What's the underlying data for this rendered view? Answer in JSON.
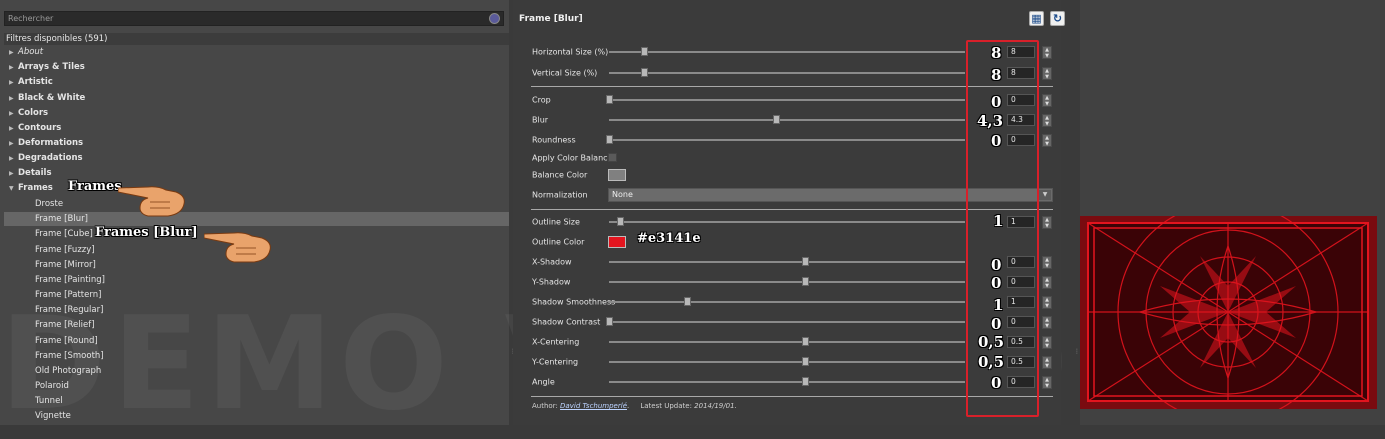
{
  "search": {
    "placeholder": "Rechercher"
  },
  "filters_header": "Filtres disponibles (591)",
  "tree": {
    "categories": [
      "About",
      "Arrays & Tiles",
      "Artistic",
      "Black & White",
      "Colors",
      "Contours",
      "Deformations",
      "Degradations",
      "Details",
      "Frames"
    ],
    "frames_children": [
      "Droste",
      "Frame [Blur]",
      "Frame [Cube]",
      "Frame [Fuzzy]",
      "Frame [Mirror]",
      "Frame [Painting]",
      "Frame [Pattern]",
      "Frame [Regular]",
      "Frame [Relief]",
      "Frame [Round]",
      "Frame [Smooth]",
      "Old Photograph",
      "Polaroid",
      "Tunnel",
      "Vignette"
    ],
    "selected": "Frame [Blur]"
  },
  "watermark": "DEMO VERSION",
  "annotations": {
    "frames": "Frames",
    "frame_blur": "Frames [Blur]",
    "outline_color_hex": "#e3141e",
    "values": [
      "8",
      "8",
      "0",
      "4,3",
      "0",
      "1",
      "0",
      "0",
      "1",
      "0",
      "0,5",
      "0,5",
      "0"
    ]
  },
  "panel": {
    "title": "Frame [Blur]",
    "params": {
      "horizontal_size": {
        "label": "Horizontal Size (%)",
        "value": "8",
        "fraction": 0.098
      },
      "vertical_size": {
        "label": "Vertical Size (%)",
        "value": "8",
        "fraction": 0.098
      },
      "crop": {
        "label": "Crop",
        "value": "0",
        "fraction": 0.0
      },
      "blur": {
        "label": "Blur",
        "value": "4.3",
        "fraction": 0.47
      },
      "roundness": {
        "label": "Roundness",
        "value": "0",
        "fraction": 0.0
      },
      "apply_color_balance": {
        "label": "Apply Color Balance",
        "checked": false
      },
      "balance_color": {
        "label": "Balance Color",
        "color": "#808080"
      },
      "normalization": {
        "label": "Normalization",
        "value": "None"
      },
      "outline_size": {
        "label": "Outline Size",
        "value": "1",
        "fraction": 0.03
      },
      "outline_color": {
        "label": "Outline Color",
        "color": "#e3141e"
      },
      "x_shadow": {
        "label": "X-Shadow",
        "value": "0",
        "fraction": 0.55
      },
      "y_shadow": {
        "label": "Y-Shadow",
        "value": "0",
        "fraction": 0.55
      },
      "shadow_smoothness": {
        "label": "Shadow Smoothness",
        "value": "1",
        "fraction": 0.22
      },
      "shadow_contrast": {
        "label": "Shadow Contrast",
        "value": "0",
        "fraction": 0.0
      },
      "x_centering": {
        "label": "X-Centering",
        "value": "0.5",
        "fraction": 0.55
      },
      "y_centering": {
        "label": "Y-Centering",
        "value": "0.5",
        "fraction": 0.55
      },
      "angle": {
        "label": "Angle",
        "value": "0",
        "fraction": 0.55
      }
    },
    "footer": {
      "author_label": "Author:",
      "author": "David Tschumperlé",
      "update_label": "Latest Update:",
      "update": "2014/19/01."
    }
  },
  "colors": {
    "highlight": "#d8202a",
    "outline": "#e3141e"
  },
  "icons": [
    "search-icon",
    "layers-icon",
    "refresh-icon",
    "pointing-hand-icon"
  ]
}
